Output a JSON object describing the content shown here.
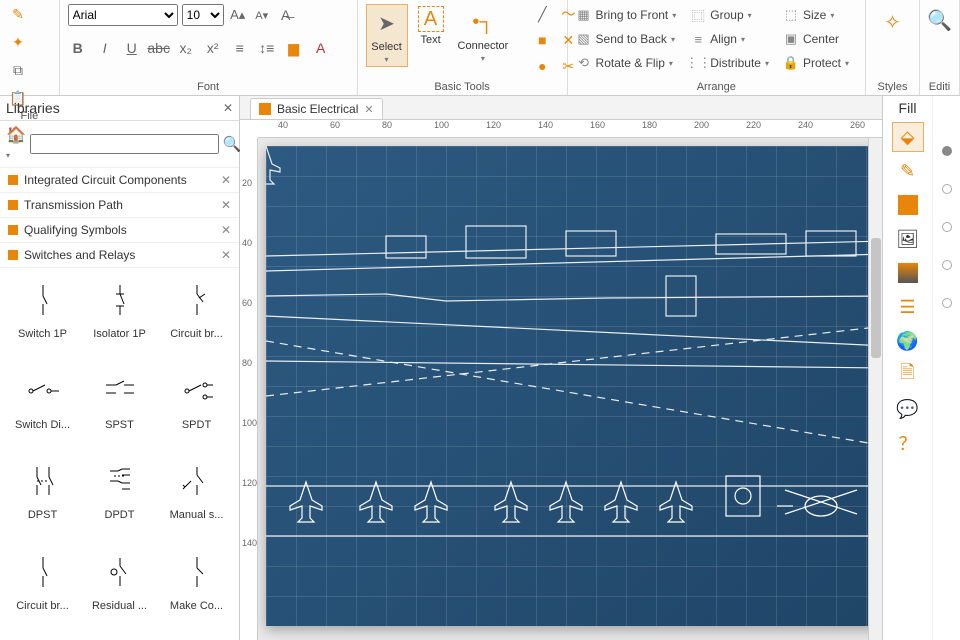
{
  "ribbon": {
    "file": {
      "label": "File"
    },
    "font": {
      "label": "Font",
      "family": "Arial",
      "size": "10"
    },
    "basic_tools": {
      "label": "Basic Tools",
      "select": "Select",
      "text": "Text",
      "connector": "Connector"
    },
    "arrange": {
      "label": "Arrange",
      "bring_front": "Bring to Front",
      "send_back": "Send to Back",
      "rotate_flip": "Rotate & Flip",
      "group": "Group",
      "align": "Align",
      "distribute": "Distribute",
      "size": "Size",
      "center": "Center",
      "protect": "Protect"
    },
    "styles": {
      "label": "Styles"
    },
    "editing": {
      "label": "Editi"
    }
  },
  "libraries": {
    "title": "Libraries",
    "search_placeholder": "",
    "categories": [
      "Integrated Circuit Components",
      "Transmission Path",
      "Qualifying Symbols",
      "Switches and Relays"
    ],
    "items": [
      "Switch 1P",
      "Isolator 1P",
      "Circuit br...",
      "Switch Di...",
      "SPST",
      "SPDT",
      "DPST",
      "DPDT",
      "Manual s...",
      "Circuit br...",
      "Residual ...",
      "Make Co..."
    ]
  },
  "tab": {
    "label": "Basic Electrical"
  },
  "ruler_h": [
    "40",
    "60",
    "80",
    "100",
    "120",
    "140",
    "160",
    "180",
    "200",
    "220",
    "240",
    "260"
  ],
  "ruler_v": [
    "20",
    "40",
    "60",
    "80",
    "100",
    "120",
    "140"
  ],
  "right_panel": {
    "title": "Fill"
  }
}
